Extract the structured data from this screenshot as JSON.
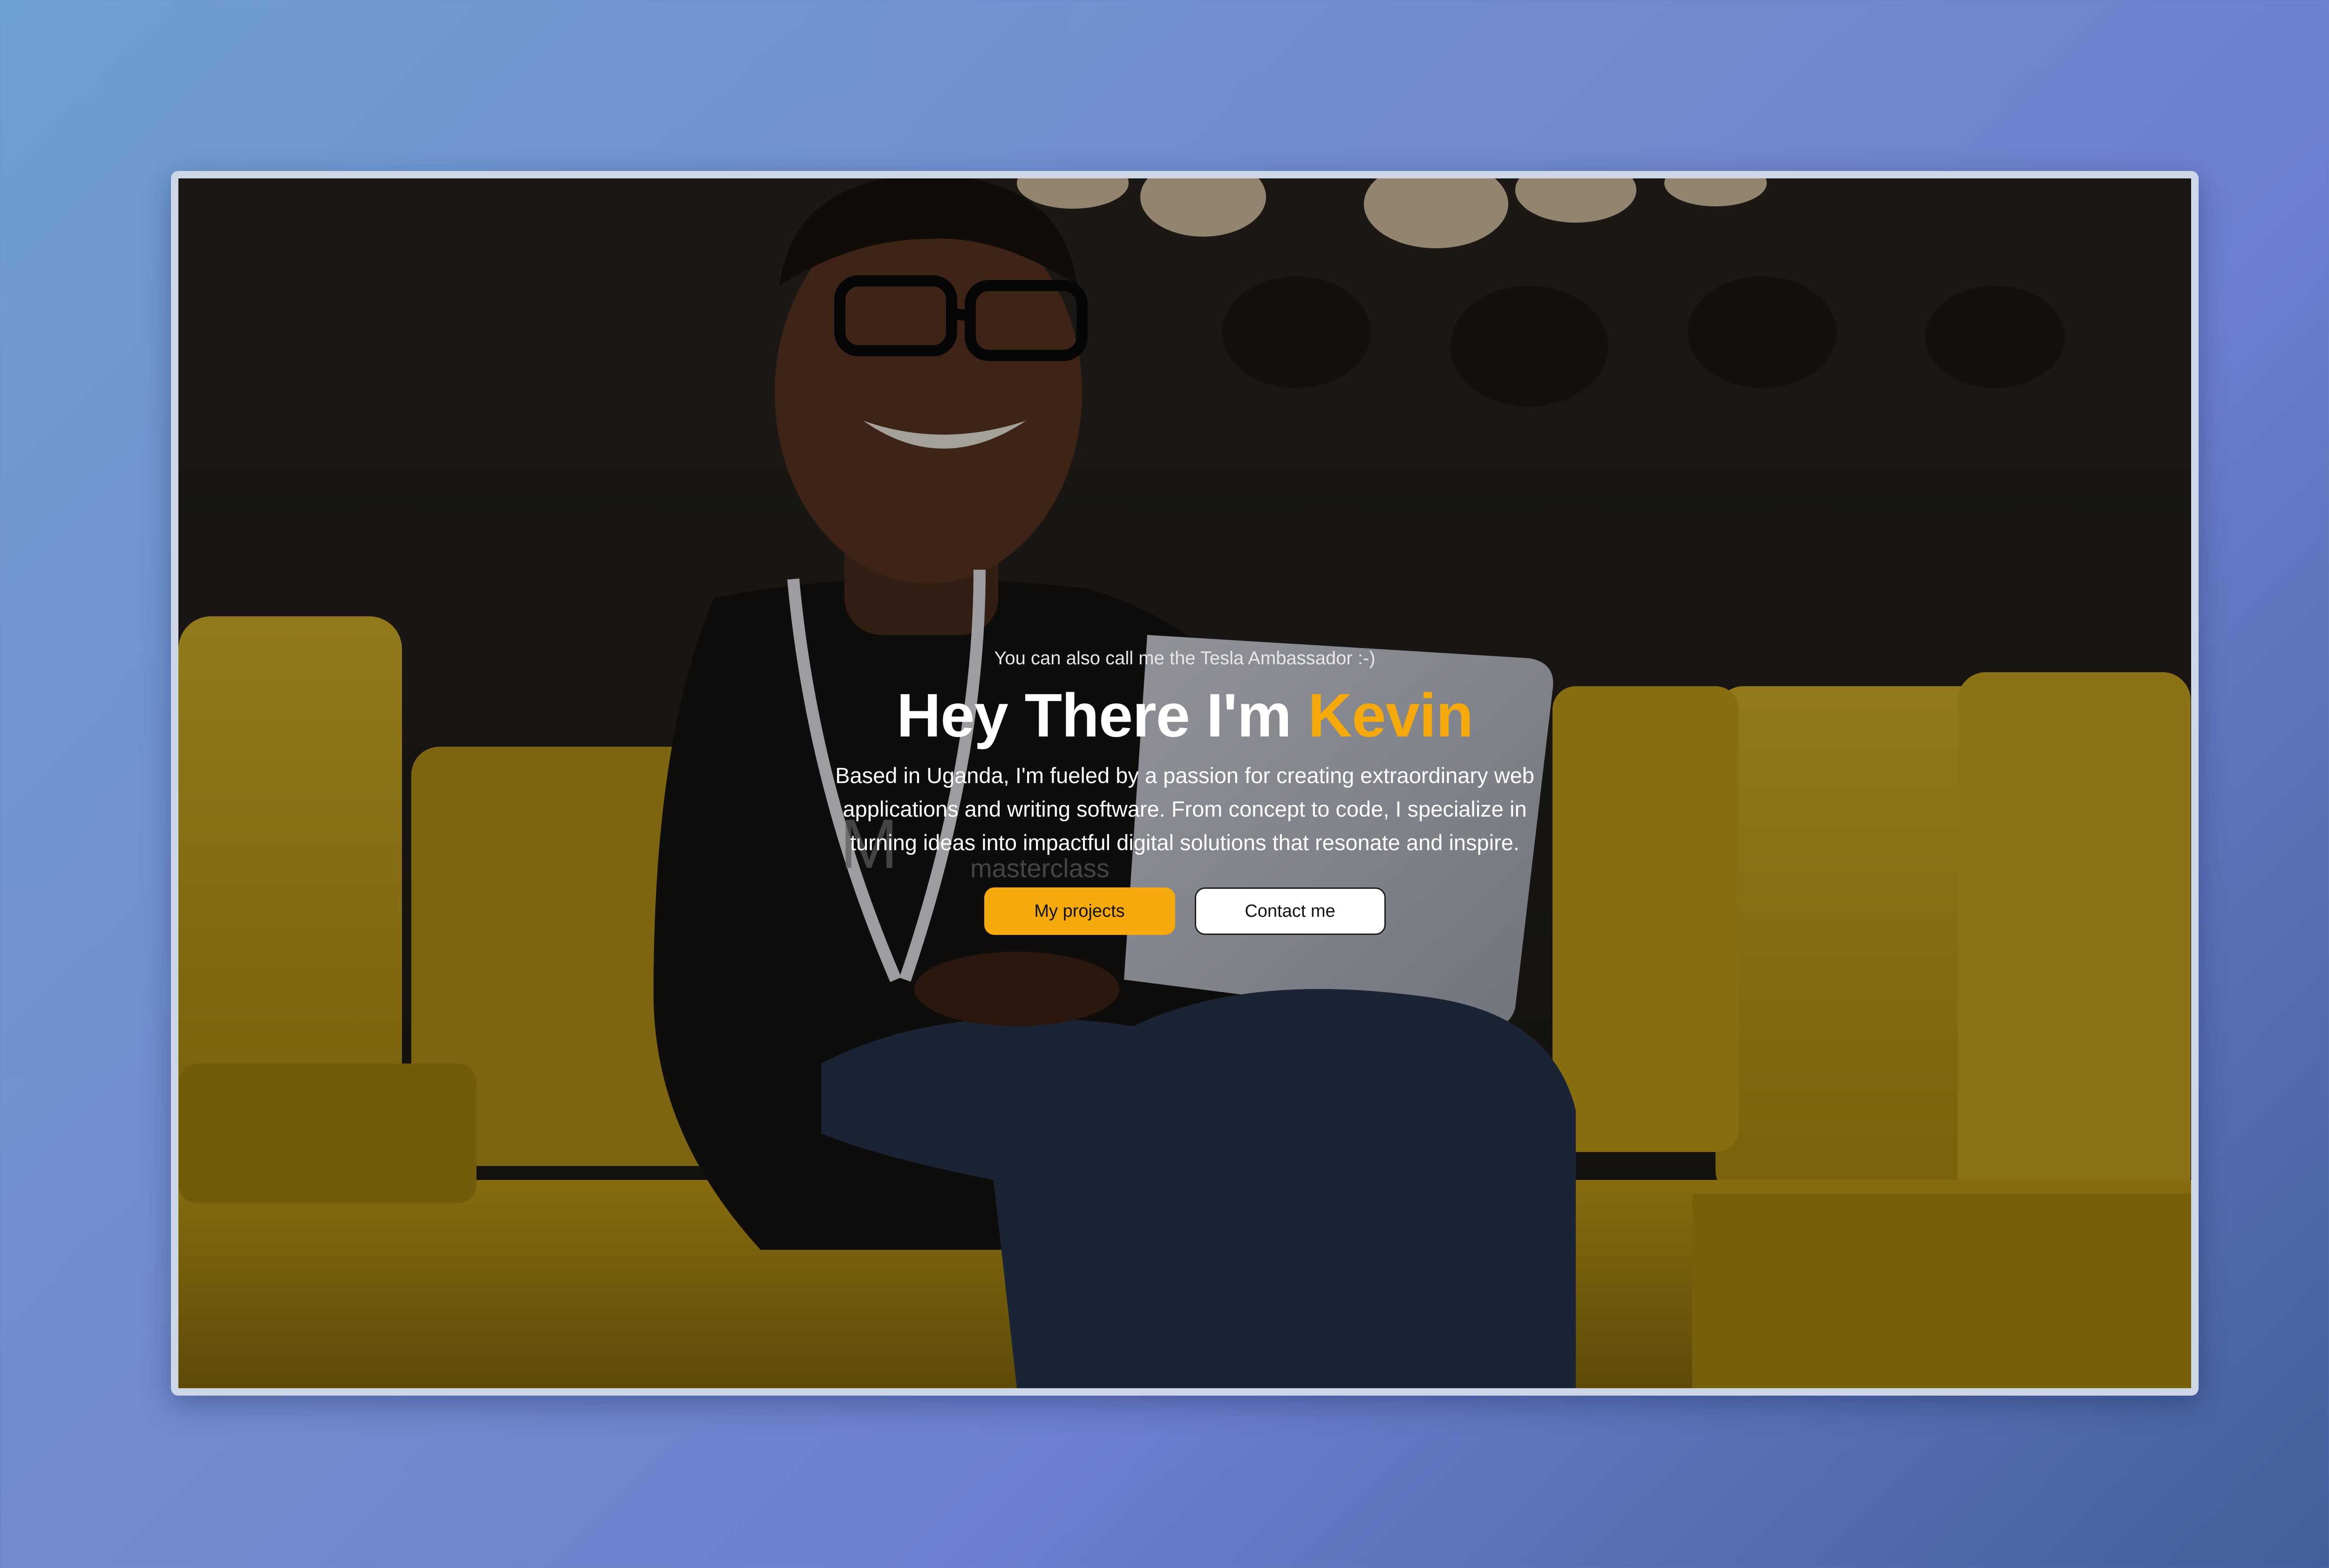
{
  "hero": {
    "tagline": "You can also call me the Tesla Ambassador :-)",
    "heading_prefix": "Hey There I'm ",
    "heading_name": "Kevin",
    "bio": "Based in Uganda, I'm fueled by a passion for creating extraordinary web applications and writing software. From concept to code, I specialize in turning ideas into impactful digital solutions that resonate and inspire.",
    "buttons": {
      "projects_label": "My projects",
      "contact_label": "Contact me"
    }
  },
  "colors": {
    "accent": "#f5a90a",
    "background_gradient_start": "#6e9fd2",
    "background_gradient_end": "#41609a",
    "sofa": "#c9a31a"
  }
}
